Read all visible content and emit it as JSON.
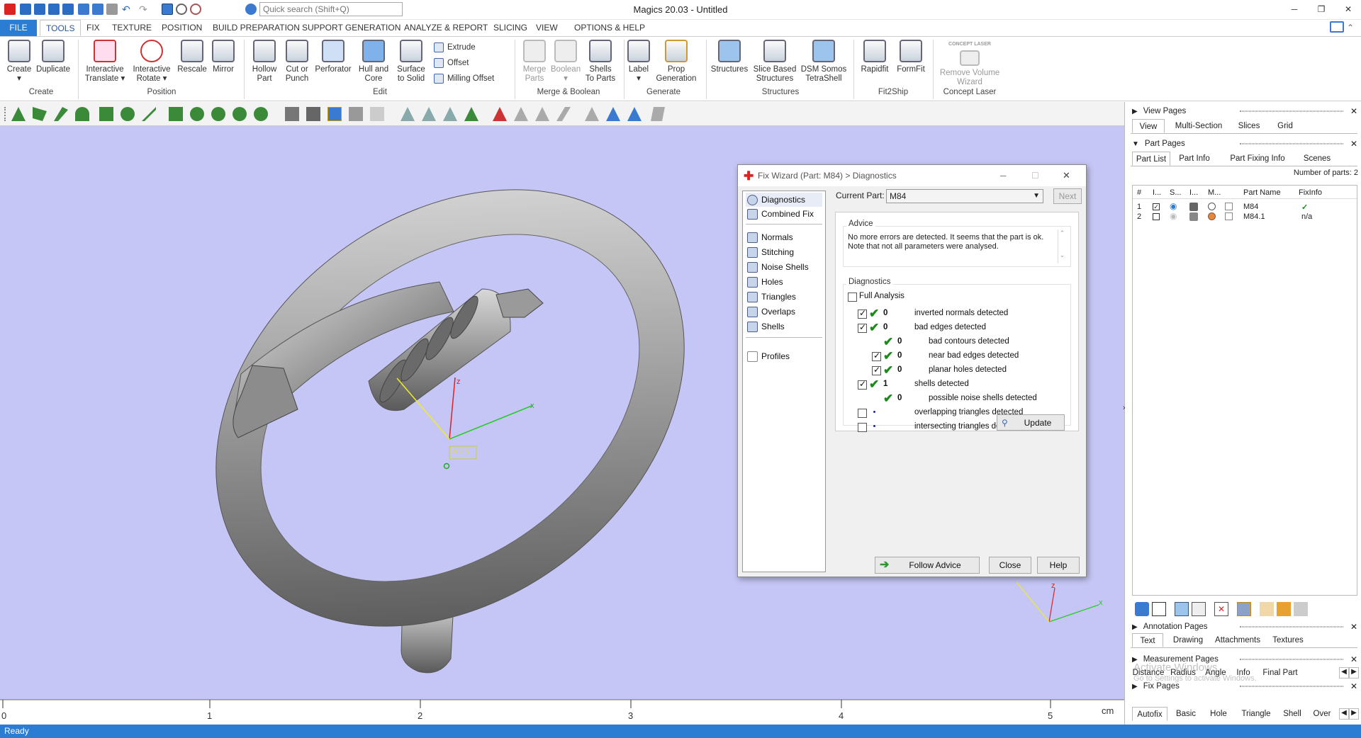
{
  "title": "Magics 20.03 - Untitled",
  "search": {
    "placeholder": "Quick search (Shift+Q)"
  },
  "menu_tabs": [
    "FILE",
    "TOOLS",
    "FIX",
    "TEXTURE",
    "POSITION",
    "BUILD PREPARATION",
    "SUPPORT GENERATION",
    "ANALYZE & REPORT",
    "SLICING",
    "VIEW",
    "OPTIONS & HELP"
  ],
  "ribbon": {
    "create": {
      "create": "Create",
      "duplicate": "Duplicate",
      "group": "Create"
    },
    "position": {
      "translate1": "Interactive",
      "translate2": "Translate",
      "rotate1": "Interactive",
      "rotate2": "Rotate",
      "rescale": "Rescale",
      "mirror": "Mirror",
      "group": "Position"
    },
    "edit": {
      "hollow1": "Hollow",
      "hollow2": "Part",
      "cut1": "Cut or",
      "cut2": "Punch",
      "perforator": "Perforator",
      "hull1": "Hull and",
      "hull2": "Core",
      "surface1": "Surface",
      "surface2": "to Solid",
      "extrude": "Extrude",
      "offset": "Offset",
      "milling": "Milling Offset",
      "group": "Edit"
    },
    "merge": {
      "merge1": "Merge",
      "merge2": "Parts",
      "boolean": "Boolean",
      "shells1": "Shells",
      "shells2": "To Parts",
      "group": "Merge & Boolean"
    },
    "generate": {
      "label": "Label",
      "prop1": "Prop",
      "prop2": "Generation",
      "group": "Generate"
    },
    "structures": {
      "structures": "Structures",
      "slice1": "Slice Based",
      "slice2": "Structures",
      "dsm1": "DSM Somos",
      "dsm2": "TetraShell",
      "group": "Structures"
    },
    "fit2ship": {
      "rapidfit": "Rapidfit",
      "formfit": "FormFit",
      "group": "Fit2Ship"
    },
    "concept": {
      "logo": "CONCEPT LASER",
      "remove1": "Remove Volume",
      "remove2": "Wizard",
      "group": "Concept Laser"
    }
  },
  "viewport": {
    "wcs_label": "WCS",
    "axis_x": "x",
    "axis_z": "z",
    "bg_color": "#c6c6f6"
  },
  "ruler": {
    "labels": [
      "0",
      "1",
      "2",
      "3",
      "4",
      "5"
    ],
    "unit": "cm"
  },
  "status": "Ready",
  "dialog": {
    "title": "Fix Wizard (Part: M84) > Diagnostics",
    "nav": [
      "Diagnostics",
      "Combined Fix",
      "Normals",
      "Stitching",
      "Noise Shells",
      "Holes",
      "Triangles",
      "Overlaps",
      "Shells",
      "Profiles"
    ],
    "current_part_label": "Current Part:",
    "current_part": "M84",
    "next": "Next",
    "advice_legend": "Advice",
    "advice_text": "No more errors are detected. It seems that the part is ok. Note that not all parameters were analysed.",
    "diag_legend": "Diagnostics",
    "full_analysis": "Full Analysis",
    "rows": [
      {
        "count": "0",
        "text": "inverted normals detected"
      },
      {
        "count": "0",
        "text": "bad edges detected"
      },
      {
        "count": "0",
        "text": "bad contours detected"
      },
      {
        "count": "0",
        "text": "near bad edges detected"
      },
      {
        "count": "0",
        "text": "planar holes detected"
      },
      {
        "count": "1",
        "text": "shells detected"
      },
      {
        "count": "0",
        "text": "possible noise shells detected"
      },
      {
        "count": "",
        "text": "overlapping triangles detected"
      },
      {
        "count": "",
        "text": "intersecting triangles detected"
      }
    ],
    "update": "Update",
    "follow_advice": "Follow Advice",
    "close": "Close",
    "help": "Help"
  },
  "right_panel": {
    "view_pages": "View Pages",
    "view_tabs": [
      "View",
      "Multi-Section",
      "Slices",
      "Grid"
    ],
    "part_pages": "Part Pages",
    "part_tabs": [
      "Part List",
      "Part Info",
      "Part Fixing Info",
      "Scenes"
    ],
    "num_parts": "Number of parts: 2",
    "columns": [
      "#",
      "I...",
      "S...",
      "I...",
      "M...",
      "Part Name",
      "FixInfo"
    ],
    "parts": [
      {
        "num": "1",
        "name": "M84",
        "fix": "✓"
      },
      {
        "num": "2",
        "name": "M84.1",
        "fix": "n/a"
      }
    ],
    "annotation_pages": "Annotation Pages",
    "annotation_tabs": [
      "Text",
      "Drawing",
      "Attachments",
      "Textures"
    ],
    "measurement_pages": "Measurement Pages",
    "measurement_tabs": [
      "Distance",
      "Radius",
      "Angle",
      "Info",
      "Final Part"
    ],
    "fix_pages": "Fix Pages",
    "fix_tabs": [
      "Autofix",
      "Basic",
      "Hole",
      "Triangle",
      "Shell",
      "Over"
    ],
    "watermark1": "Activate Windows",
    "watermark2": "Go to Settings to activate Windows."
  }
}
